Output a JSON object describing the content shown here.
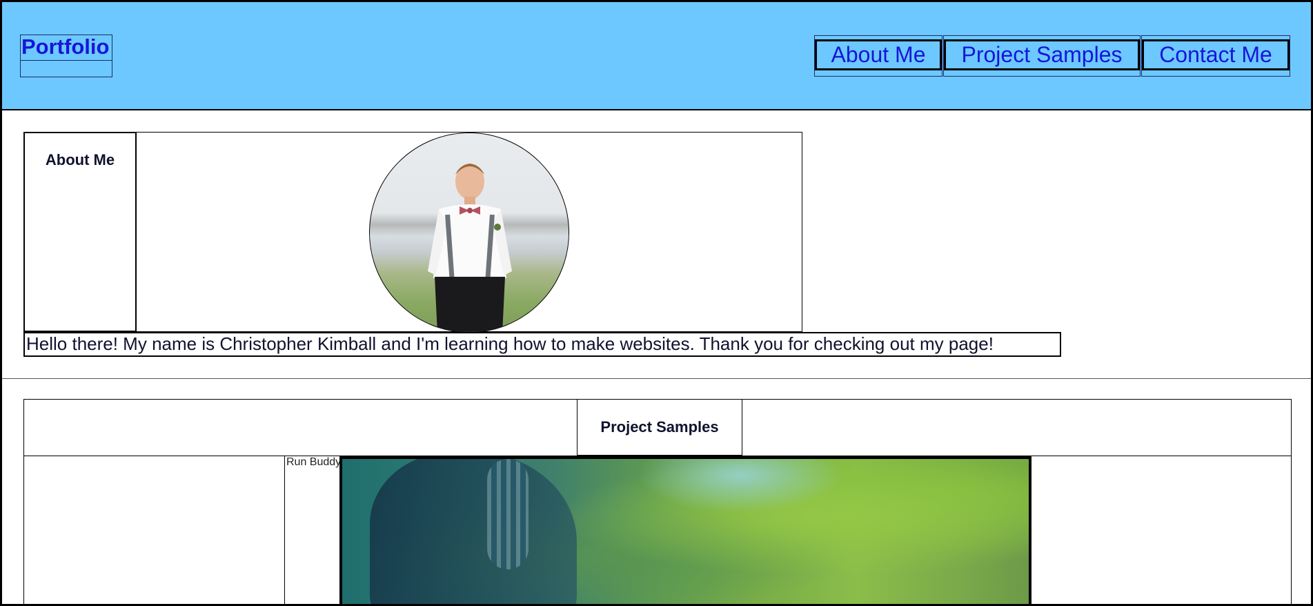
{
  "header": {
    "logo": "Portfolio",
    "nav": [
      {
        "label": "About Me"
      },
      {
        "label": "Project Samples"
      },
      {
        "label": "Contact Me"
      }
    ]
  },
  "about": {
    "title": "About Me",
    "photo_alt": "Portrait of Christopher Kimball",
    "text": "Hello there! My name is Christopher Kimball and I'm learning how to make websites. Thank you for checking out my page!"
  },
  "projects": {
    "title": "Project Samples",
    "items": [
      {
        "label": "Run Buddy"
      }
    ]
  },
  "colors": {
    "header_bg": "#6cc8ff",
    "link": "#1616d8",
    "text": "#10122e"
  }
}
